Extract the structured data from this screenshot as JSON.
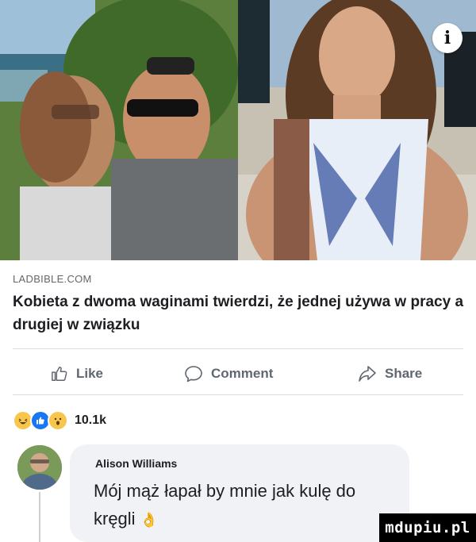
{
  "post": {
    "source": "LADBIBLE.COM",
    "headline": "Kobieta z dwoma waginami twierdzi, że jednej używa w pracy a drugiej w związku",
    "info_glyph": "i",
    "photos": [
      "couple-selfie",
      "woman-selfie"
    ]
  },
  "actions": {
    "like_label": "Like",
    "comment_label": "Comment",
    "share_label": "Share"
  },
  "reactions": {
    "icons": [
      "haha-reaction-icon",
      "like-reaction-icon",
      "wow-reaction-icon"
    ],
    "count": "10.1k"
  },
  "comment": {
    "author": "Alison Williams",
    "text": "Mój mąż łapał by mnie jak kulę do kręgli",
    "emoji": "👌"
  },
  "watermark": "mdupiu.pl",
  "colors": {
    "action_text": "#606770",
    "bubble_bg": "#f0f2f5",
    "like_blue": "#1877f2",
    "divider": "#dadde1"
  }
}
